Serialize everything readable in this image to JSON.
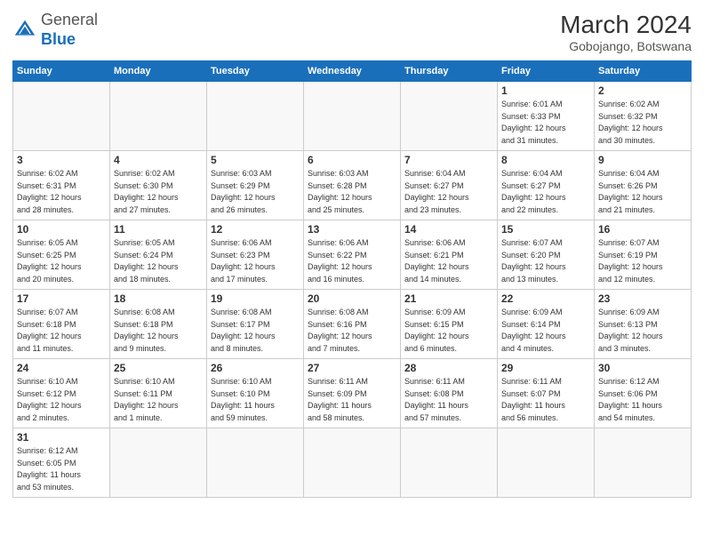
{
  "header": {
    "logo_general": "General",
    "logo_blue": "Blue",
    "month_year": "March 2024",
    "location": "Gobojango, Botswana"
  },
  "weekdays": [
    "Sunday",
    "Monday",
    "Tuesday",
    "Wednesday",
    "Thursday",
    "Friday",
    "Saturday"
  ],
  "weeks": [
    [
      {
        "day": "",
        "info": ""
      },
      {
        "day": "",
        "info": ""
      },
      {
        "day": "",
        "info": ""
      },
      {
        "day": "",
        "info": ""
      },
      {
        "day": "",
        "info": ""
      },
      {
        "day": "1",
        "info": "Sunrise: 6:01 AM\nSunset: 6:33 PM\nDaylight: 12 hours\nand 31 minutes."
      },
      {
        "day": "2",
        "info": "Sunrise: 6:02 AM\nSunset: 6:32 PM\nDaylight: 12 hours\nand 30 minutes."
      }
    ],
    [
      {
        "day": "3",
        "info": "Sunrise: 6:02 AM\nSunset: 6:31 PM\nDaylight: 12 hours\nand 28 minutes."
      },
      {
        "day": "4",
        "info": "Sunrise: 6:02 AM\nSunset: 6:30 PM\nDaylight: 12 hours\nand 27 minutes."
      },
      {
        "day": "5",
        "info": "Sunrise: 6:03 AM\nSunset: 6:29 PM\nDaylight: 12 hours\nand 26 minutes."
      },
      {
        "day": "6",
        "info": "Sunrise: 6:03 AM\nSunset: 6:28 PM\nDaylight: 12 hours\nand 25 minutes."
      },
      {
        "day": "7",
        "info": "Sunrise: 6:04 AM\nSunset: 6:27 PM\nDaylight: 12 hours\nand 23 minutes."
      },
      {
        "day": "8",
        "info": "Sunrise: 6:04 AM\nSunset: 6:27 PM\nDaylight: 12 hours\nand 22 minutes."
      },
      {
        "day": "9",
        "info": "Sunrise: 6:04 AM\nSunset: 6:26 PM\nDaylight: 12 hours\nand 21 minutes."
      }
    ],
    [
      {
        "day": "10",
        "info": "Sunrise: 6:05 AM\nSunset: 6:25 PM\nDaylight: 12 hours\nand 20 minutes."
      },
      {
        "day": "11",
        "info": "Sunrise: 6:05 AM\nSunset: 6:24 PM\nDaylight: 12 hours\nand 18 minutes."
      },
      {
        "day": "12",
        "info": "Sunrise: 6:06 AM\nSunset: 6:23 PM\nDaylight: 12 hours\nand 17 minutes."
      },
      {
        "day": "13",
        "info": "Sunrise: 6:06 AM\nSunset: 6:22 PM\nDaylight: 12 hours\nand 16 minutes."
      },
      {
        "day": "14",
        "info": "Sunrise: 6:06 AM\nSunset: 6:21 PM\nDaylight: 12 hours\nand 14 minutes."
      },
      {
        "day": "15",
        "info": "Sunrise: 6:07 AM\nSunset: 6:20 PM\nDaylight: 12 hours\nand 13 minutes."
      },
      {
        "day": "16",
        "info": "Sunrise: 6:07 AM\nSunset: 6:19 PM\nDaylight: 12 hours\nand 12 minutes."
      }
    ],
    [
      {
        "day": "17",
        "info": "Sunrise: 6:07 AM\nSunset: 6:18 PM\nDaylight: 12 hours\nand 11 minutes."
      },
      {
        "day": "18",
        "info": "Sunrise: 6:08 AM\nSunset: 6:18 PM\nDaylight: 12 hours\nand 9 minutes."
      },
      {
        "day": "19",
        "info": "Sunrise: 6:08 AM\nSunset: 6:17 PM\nDaylight: 12 hours\nand 8 minutes."
      },
      {
        "day": "20",
        "info": "Sunrise: 6:08 AM\nSunset: 6:16 PM\nDaylight: 12 hours\nand 7 minutes."
      },
      {
        "day": "21",
        "info": "Sunrise: 6:09 AM\nSunset: 6:15 PM\nDaylight: 12 hours\nand 6 minutes."
      },
      {
        "day": "22",
        "info": "Sunrise: 6:09 AM\nSunset: 6:14 PM\nDaylight: 12 hours\nand 4 minutes."
      },
      {
        "day": "23",
        "info": "Sunrise: 6:09 AM\nSunset: 6:13 PM\nDaylight: 12 hours\nand 3 minutes."
      }
    ],
    [
      {
        "day": "24",
        "info": "Sunrise: 6:10 AM\nSunset: 6:12 PM\nDaylight: 12 hours\nand 2 minutes."
      },
      {
        "day": "25",
        "info": "Sunrise: 6:10 AM\nSunset: 6:11 PM\nDaylight: 12 hours\nand 1 minute."
      },
      {
        "day": "26",
        "info": "Sunrise: 6:10 AM\nSunset: 6:10 PM\nDaylight: 11 hours\nand 59 minutes."
      },
      {
        "day": "27",
        "info": "Sunrise: 6:11 AM\nSunset: 6:09 PM\nDaylight: 11 hours\nand 58 minutes."
      },
      {
        "day": "28",
        "info": "Sunrise: 6:11 AM\nSunset: 6:08 PM\nDaylight: 11 hours\nand 57 minutes."
      },
      {
        "day": "29",
        "info": "Sunrise: 6:11 AM\nSunset: 6:07 PM\nDaylight: 11 hours\nand 56 minutes."
      },
      {
        "day": "30",
        "info": "Sunrise: 6:12 AM\nSunset: 6:06 PM\nDaylight: 11 hours\nand 54 minutes."
      }
    ],
    [
      {
        "day": "31",
        "info": "Sunrise: 6:12 AM\nSunset: 6:05 PM\nDaylight: 11 hours\nand 53 minutes."
      },
      {
        "day": "",
        "info": ""
      },
      {
        "day": "",
        "info": ""
      },
      {
        "day": "",
        "info": ""
      },
      {
        "day": "",
        "info": ""
      },
      {
        "day": "",
        "info": ""
      },
      {
        "day": "",
        "info": ""
      }
    ]
  ]
}
